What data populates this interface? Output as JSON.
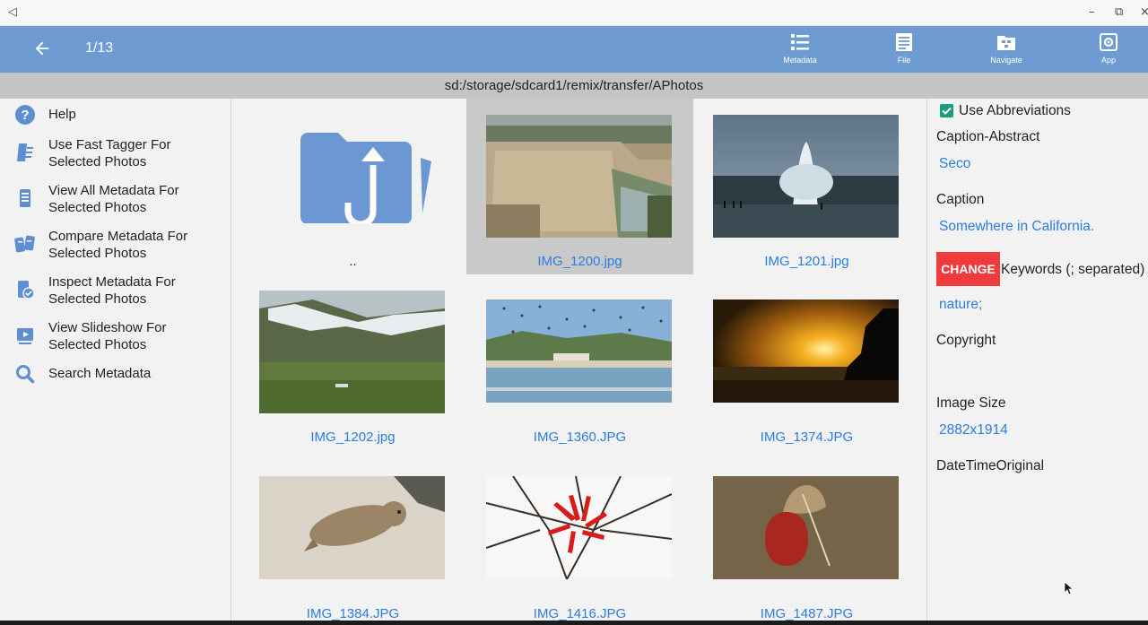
{
  "titlebar": {
    "back_glyph": "◁",
    "minimize_glyph": "–",
    "restore_glyph": "⧉",
    "close_glyph": "×"
  },
  "appbar": {
    "counter": "1/13",
    "actions": [
      {
        "label": "Metadata",
        "icon": "list-icon"
      },
      {
        "label": "File",
        "icon": "document-icon"
      },
      {
        "label": "Navigate",
        "icon": "folder-navigate-icon"
      },
      {
        "label": "App",
        "icon": "settings-icon"
      }
    ],
    "colors": {
      "bar": "#6e9bd1"
    }
  },
  "path": "sd:/storage/sdcard1/remix/transfer/APhotos",
  "menu": [
    {
      "label": "Help",
      "icon": "help-icon"
    },
    {
      "label": "Use Fast Tagger For\nSelected Photos",
      "icon": "tagger-icon"
    },
    {
      "label": "View All Metadata For\nSelected Photos",
      "icon": "metadata-list-icon"
    },
    {
      "label": "Compare Metadata For\nSelected Photos",
      "icon": "compare-icon"
    },
    {
      "label": "Inspect Metadata For\nSelected Photos",
      "icon": "inspect-icon"
    },
    {
      "label": "View Slideshow For\nSelected Photos",
      "icon": "slideshow-icon"
    },
    {
      "label": "Search Metadata",
      "icon": "search-icon"
    }
  ],
  "grid": {
    "items": [
      {
        "label": "..",
        "kind": "parent-folder",
        "selected": false
      },
      {
        "label": "IMG_1200.jpg",
        "kind": "photo",
        "selected": true
      },
      {
        "label": "IMG_1201.jpg",
        "kind": "photo",
        "selected": false
      },
      {
        "label": "IMG_1202.jpg",
        "kind": "photo",
        "selected": false
      },
      {
        "label": "IMG_1360.JPG",
        "kind": "photo",
        "selected": false
      },
      {
        "label": "IMG_1374.JPG",
        "kind": "photo",
        "selected": false
      },
      {
        "label": "IMG_1384.JPG",
        "kind": "photo",
        "selected": false
      },
      {
        "label": "IMG_1416.JPG",
        "kind": "photo",
        "selected": false
      },
      {
        "label": "IMG_1487.JPG",
        "kind": "photo",
        "selected": false
      }
    ],
    "colors": {
      "label": "#2a7de1",
      "selected": "#c9c9c9"
    }
  },
  "details": {
    "use_abbreviations_label": "Use Abbreviations",
    "use_abbreviations_checked": true,
    "caption_abstract_label": "Caption-Abstract",
    "caption_abstract_value": "Seco",
    "caption_label": "Caption",
    "caption_value": "Somewhere in California.",
    "change_label": "CHANGE",
    "keywords_label": "Keywords (; separated)",
    "keywords_value": "nature;",
    "copyright_label": "Copyright",
    "copyright_value": "",
    "image_size_label": "Image Size",
    "image_size_value": "2882x1914",
    "datetime_label": "DateTimeOriginal",
    "datetime_value": "",
    "colors": {
      "value": "#2a7de1",
      "change": "#ef3b3b",
      "check": "#1a9c84"
    }
  }
}
